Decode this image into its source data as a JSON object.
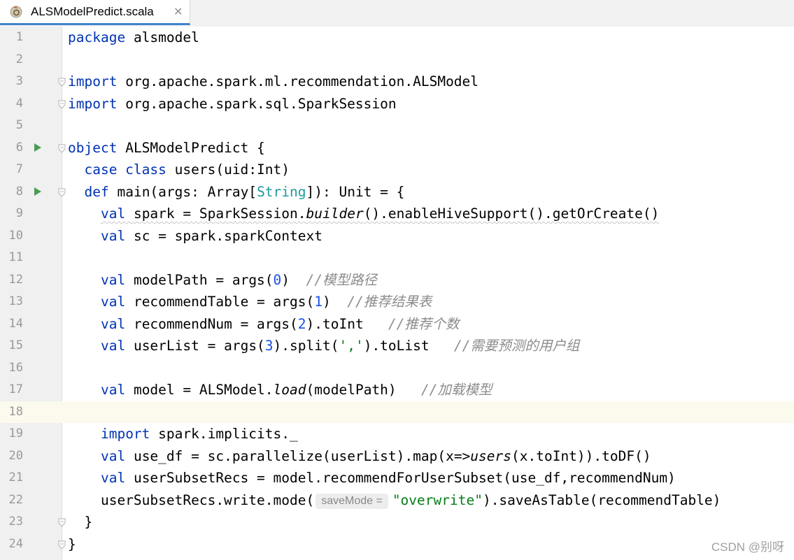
{
  "tab": {
    "filename": "ALSModelPredict.scala",
    "close_glyph": "✕",
    "icon": "scala-object-icon"
  },
  "editor": {
    "current_line": 18,
    "run_gutter_lines": [
      6,
      8
    ],
    "fold_lines": [
      3,
      4,
      6,
      8,
      23,
      24
    ],
    "lines": [
      {
        "num": "1",
        "tokens": [
          [
            "kw",
            "package"
          ],
          [
            "",
            "alsmodel"
          ]
        ]
      },
      {
        "num": "2",
        "tokens": []
      },
      {
        "num": "3",
        "tokens": [
          [
            "kw",
            "import"
          ],
          [
            "",
            "org.apache.spark.ml.recommendation.ALSModel"
          ]
        ]
      },
      {
        "num": "4",
        "tokens": [
          [
            "kw",
            "import"
          ],
          [
            "",
            "org.apache.spark.sql.SparkSession"
          ]
        ]
      },
      {
        "num": "5",
        "tokens": []
      },
      {
        "num": "6",
        "tokens": [
          [
            "kw",
            "object"
          ],
          [
            "",
            "ALSModelPredict {"
          ]
        ]
      },
      {
        "num": "7",
        "tokens": [
          [
            "",
            "  "
          ],
          [
            "kw",
            "case class"
          ],
          [
            "",
            "users(uid:Int)"
          ]
        ]
      },
      {
        "num": "8",
        "tokens": [
          [
            "",
            "  "
          ],
          [
            "kw",
            "def"
          ],
          [
            "",
            "main(args: Array["
          ],
          [
            "tparam",
            "String"
          ],
          [
            "",
            "]): Unit = {"
          ]
        ]
      },
      {
        "num": "9",
        "tokens": [
          [
            "",
            "    "
          ],
          [
            "kw wavy",
            "val"
          ],
          [
            "wavy",
            "spark = SparkSession."
          ],
          [
            "it wavy",
            "builder"
          ],
          [
            "wavy",
            "().enableHiveSupport().getOrCreate()"
          ]
        ]
      },
      {
        "num": "10",
        "tokens": [
          [
            "",
            "    "
          ],
          [
            "kw",
            "val"
          ],
          [
            "",
            "sc = spark.sparkContext"
          ]
        ]
      },
      {
        "num": "11",
        "tokens": []
      },
      {
        "num": "12",
        "tokens": [
          [
            "",
            "    "
          ],
          [
            "kw",
            "val"
          ],
          [
            "",
            "modelPath = args("
          ],
          [
            "num",
            "0"
          ],
          [
            "",
            ")  "
          ],
          [
            "cmt",
            "//模型路径"
          ]
        ]
      },
      {
        "num": "13",
        "tokens": [
          [
            "",
            "    "
          ],
          [
            "kw",
            "val"
          ],
          [
            "",
            "recommendTable = args("
          ],
          [
            "num",
            "1"
          ],
          [
            "",
            ")  "
          ],
          [
            "cmt",
            "//推荐结果表"
          ]
        ]
      },
      {
        "num": "14",
        "tokens": [
          [
            "",
            "    "
          ],
          [
            "kw",
            "val"
          ],
          [
            "",
            "recommendNum = args("
          ],
          [
            "num",
            "2"
          ],
          [
            "",
            ").toInt   "
          ],
          [
            "cmt",
            "//推荐个数"
          ]
        ]
      },
      {
        "num": "15",
        "tokens": [
          [
            "",
            "    "
          ],
          [
            "kw",
            "val"
          ],
          [
            "",
            "userList = args("
          ],
          [
            "num",
            "3"
          ],
          [
            "",
            ").split("
          ],
          [
            "str",
            "','"
          ],
          [
            "",
            ").toList   "
          ],
          [
            "cmt",
            "//需要预测的用户组"
          ]
        ]
      },
      {
        "num": "16",
        "tokens": []
      },
      {
        "num": "17",
        "tokens": [
          [
            "",
            "    "
          ],
          [
            "kw",
            "val"
          ],
          [
            "",
            "model = ALSModel."
          ],
          [
            "it",
            "load"
          ],
          [
            "",
            "(modelPath)   "
          ],
          [
            "cmt",
            "//加载模型"
          ]
        ]
      },
      {
        "num": "18",
        "tokens": []
      },
      {
        "num": "19",
        "tokens": [
          [
            "",
            "    "
          ],
          [
            "kw",
            "import"
          ],
          [
            "",
            "spark.implicits._"
          ]
        ]
      },
      {
        "num": "20",
        "tokens": [
          [
            "",
            "    "
          ],
          [
            "kw",
            "val"
          ],
          [
            "",
            "use_df = sc.parallelize(userList).map(x=>"
          ],
          [
            "it",
            "users"
          ],
          [
            "",
            "(x.toInt)).toDF()"
          ]
        ]
      },
      {
        "num": "21",
        "tokens": [
          [
            "",
            "    "
          ],
          [
            "kw",
            "val"
          ],
          [
            "",
            "userSubsetRecs = model.recommendForUserSubset(use_df,recommendNum)"
          ]
        ]
      },
      {
        "num": "22",
        "tokens": [
          [
            "",
            "    userSubsetRecs.write.mode("
          ],
          [
            "hint",
            "saveMode ="
          ],
          [
            "str",
            "\"overwrite\""
          ],
          [
            "",
            ").saveAsTable(recommendTable)"
          ]
        ]
      },
      {
        "num": "23",
        "tokens": [
          [
            "",
            "  }"
          ]
        ]
      },
      {
        "num": "24",
        "tokens": [
          [
            "",
            "}"
          ]
        ]
      }
    ]
  },
  "watermark": "CSDN @别呀"
}
